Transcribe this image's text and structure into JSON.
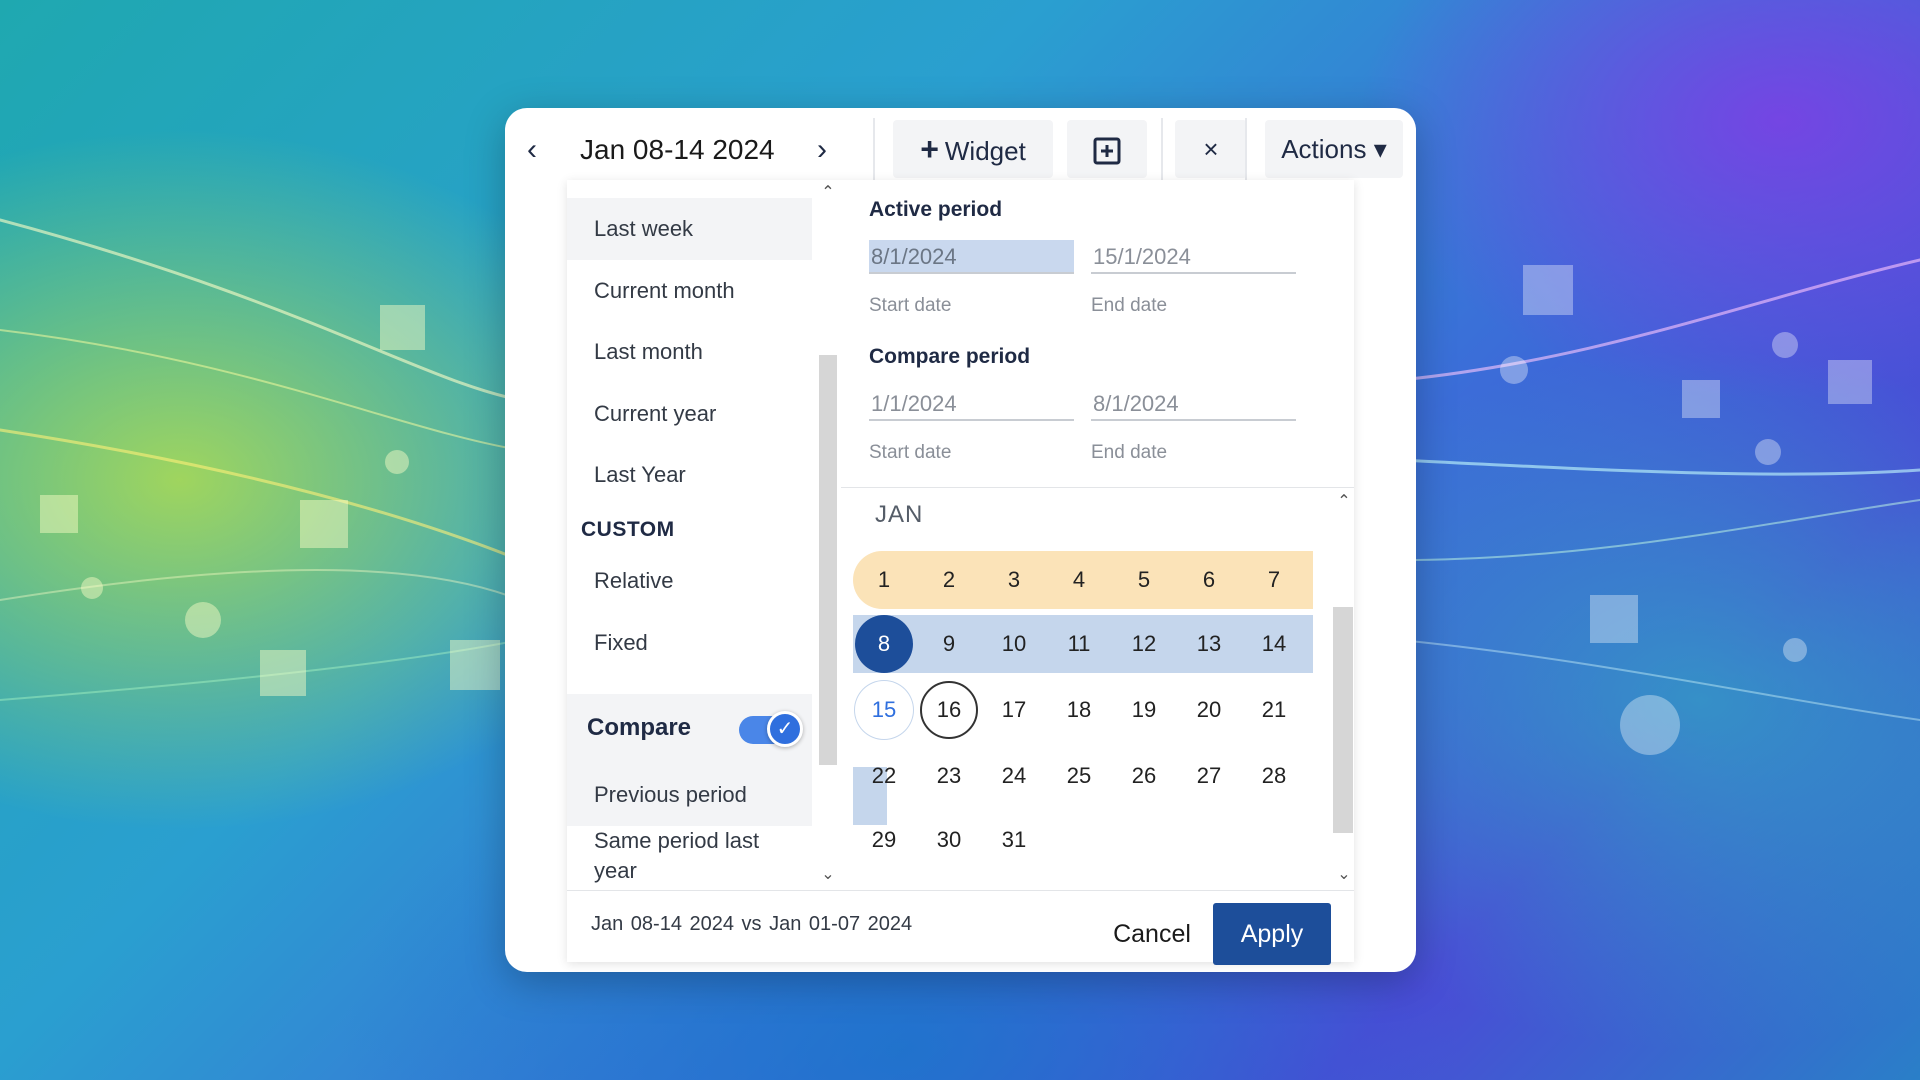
{
  "toolbar": {
    "prev_icon": "chevron-left-icon",
    "date_title": "Jan 08-14 2024",
    "next_icon": "chevron-right-icon",
    "widget_label": "Widget",
    "add_icon": "plus-square-icon",
    "close_label": "×",
    "actions_label": "Actions ▾"
  },
  "sidebar": {
    "items": [
      {
        "label": "Last week"
      },
      {
        "label": "Current month"
      },
      {
        "label": "Last month"
      },
      {
        "label": "Current year"
      },
      {
        "label": "Last Year"
      }
    ],
    "custom_heading": "CUSTOM",
    "custom_items": [
      {
        "label": "Relative"
      },
      {
        "label": "Fixed"
      }
    ],
    "compare_label": "Compare",
    "compare_enabled": true,
    "compare_items": [
      {
        "label": "Previous period"
      },
      {
        "label": "Same period last year"
      }
    ]
  },
  "active_period": {
    "heading": "Active period",
    "start_value": "8/1/2024",
    "end_value": "15/1/2024",
    "start_label": "Start date",
    "end_label": "End date"
  },
  "compare_period": {
    "heading": "Compare period",
    "start_value": "1/1/2024",
    "end_value": "8/1/2024",
    "start_label": "Start date",
    "end_label": "End date"
  },
  "calendar": {
    "month": "JAN",
    "weeks": [
      [
        "1",
        "2",
        "3",
        "4",
        "5",
        "6",
        "7"
      ],
      [
        "8",
        "9",
        "10",
        "11",
        "12",
        "13",
        "14"
      ],
      [
        "15",
        "16",
        "17",
        "18",
        "19",
        "20",
        "21"
      ],
      [
        "22",
        "23",
        "24",
        "25",
        "26",
        "27",
        "28"
      ],
      [
        "29",
        "30",
        "31"
      ]
    ]
  },
  "footer": {
    "summary": "Jan 08-14 2024  vs  Jan 01-07 2024",
    "cancel_label": "Cancel",
    "apply_label": "Apply"
  },
  "colors": {
    "primary": "#1d4e9a",
    "active_band": "#c5d6ec",
    "compare_band": "#fbe3b8",
    "toggle": "#4a86e8"
  }
}
